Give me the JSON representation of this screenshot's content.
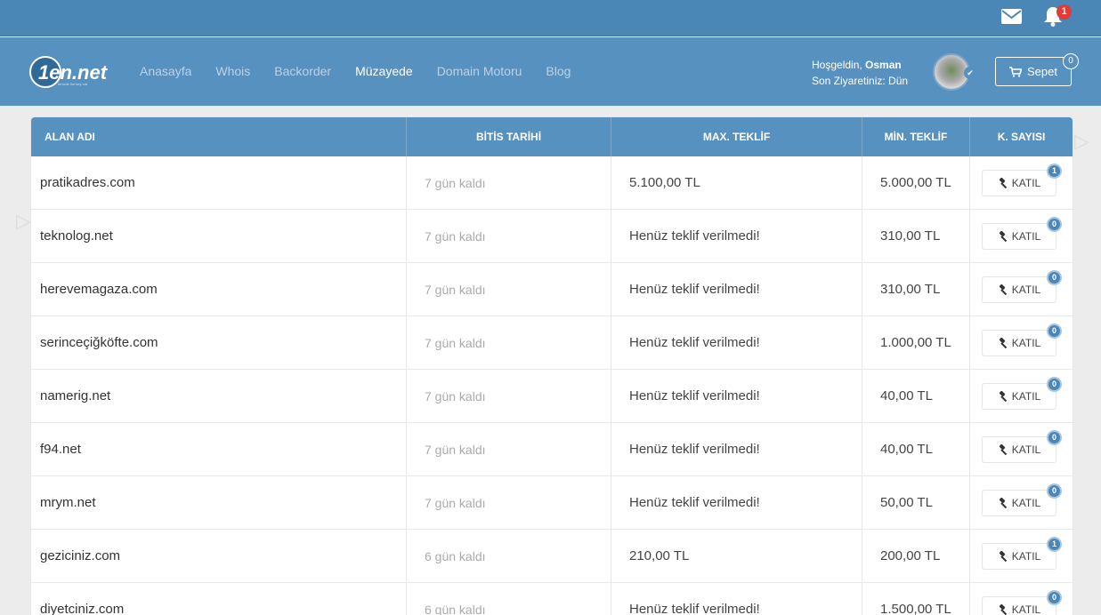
{
  "topbar": {
    "notification_count": "1"
  },
  "navbar": {
    "logo_text": "1en.net",
    "links": [
      {
        "label": "Anasayfa",
        "active": false
      },
      {
        "label": "Whois",
        "active": false
      },
      {
        "label": "Backorder",
        "active": false
      },
      {
        "label": "Müzayede",
        "active": true
      },
      {
        "label": "Domain Motoru",
        "active": false
      },
      {
        "label": "Blog",
        "active": false
      }
    ],
    "welcome_prefix": "Hoşgeldin,",
    "user_name": "Osman",
    "last_visit": "Son Ziyaretiniz: Dün",
    "cart_label": "Sepet",
    "cart_count": "0"
  },
  "table": {
    "headers": [
      "ALAN ADI",
      "BİTİS TARİHİ",
      "MAX. TEKLİF",
      "MİN. TEKLİF",
      "K. SAYISI"
    ],
    "join_label": "KATIL",
    "rows": [
      {
        "domain": "pratikadres.com",
        "ends": "7 gün kaldı",
        "max_bid": "5.100,00 TL",
        "min_bid": "5.000,00 TL",
        "bids": "1"
      },
      {
        "domain": "teknolog.net",
        "ends": "7 gün kaldı",
        "max_bid": "Henüz teklif verilmedi!",
        "min_bid": "310,00 TL",
        "bids": "0"
      },
      {
        "domain": "herevemagaza.com",
        "ends": "7 gün kaldı",
        "max_bid": "Henüz teklif verilmedi!",
        "min_bid": "310,00 TL",
        "bids": "0"
      },
      {
        "domain": "serinceçiğköfte.com",
        "ends": "7 gün kaldı",
        "max_bid": "Henüz teklif verilmedi!",
        "min_bid": "1.000,00 TL",
        "bids": "0"
      },
      {
        "domain": "namerig.net",
        "ends": "7 gün kaldı",
        "max_bid": "Henüz teklif verilmedi!",
        "min_bid": "40,00 TL",
        "bids": "0"
      },
      {
        "domain": "f94.net",
        "ends": "7 gün kaldı",
        "max_bid": "Henüz teklif verilmedi!",
        "min_bid": "40,00 TL",
        "bids": "0"
      },
      {
        "domain": "mrym.net",
        "ends": "7 gün kaldı",
        "max_bid": "Henüz teklif verilmedi!",
        "min_bid": "50,00 TL",
        "bids": "0"
      },
      {
        "domain": "geziciniz.com",
        "ends": "6 gün kaldı",
        "max_bid": "210,00 TL",
        "min_bid": "200,00 TL",
        "bids": "1"
      },
      {
        "domain": "diyetciniz.com",
        "ends": "6 gün kaldı",
        "max_bid": "Henüz teklif verilmedi!",
        "min_bid": "1.500,00 TL",
        "bids": "0"
      }
    ]
  },
  "colors": {
    "topbar": "#4a86b6",
    "navbar": "#5791c0",
    "badge_red": "#e53935"
  }
}
